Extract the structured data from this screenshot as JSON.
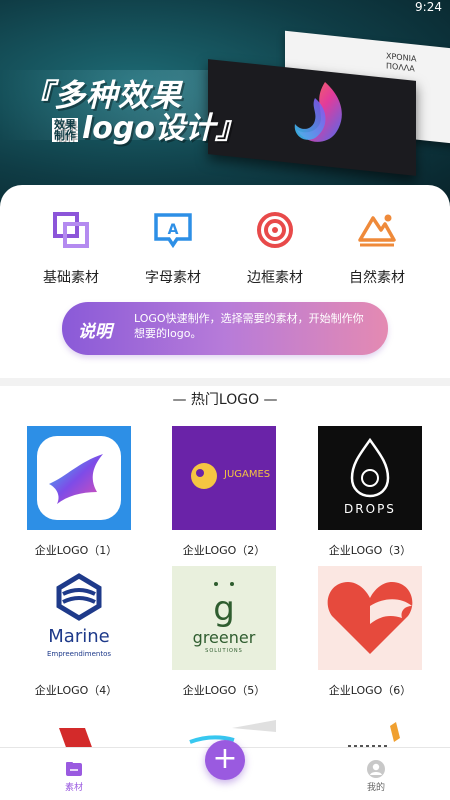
{
  "status": {
    "time": "9:24"
  },
  "banner": {
    "title": "『多种效果",
    "subtitle_small": "效果制作",
    "subtitle": "logo设计』",
    "paper_text": "ΧΡΟΝΙΑ ΠΟΛΛΑ"
  },
  "categories": [
    {
      "label": "基础素材",
      "icon": "basic-material-icon",
      "color": "#8c55d9"
    },
    {
      "label": "字母素材",
      "icon": "letter-material-icon",
      "color": "#2d8fe6"
    },
    {
      "label": "边框素材",
      "icon": "frame-material-icon",
      "color": "#e84a4a"
    },
    {
      "label": "自然素材",
      "icon": "nature-material-icon",
      "color": "#ef8a3a"
    }
  ],
  "tip": {
    "title": "说明",
    "text": "LOGO快速制作，选择需要的素材，开始制作你想要的logo。"
  },
  "section_title": "— 热门LOGO —",
  "logos": [
    {
      "caption": "企业LOGO（1）",
      "text": ""
    },
    {
      "caption": "企业LOGO（2）",
      "text": "JUGAMES"
    },
    {
      "caption": "企业LOGO（3）",
      "text": "DROPS"
    },
    {
      "caption": "企业LOGO（4）",
      "text": "Marine",
      "subtext": "Empreendimentos"
    },
    {
      "caption": "企业LOGO（5）",
      "text": "greener",
      "subtext": "SOLUTIONS"
    },
    {
      "caption": "企业LOGO（6）",
      "text": ""
    }
  ],
  "nav": {
    "left_label": "素材",
    "right_label": "我的",
    "fab_symbol": "+"
  }
}
